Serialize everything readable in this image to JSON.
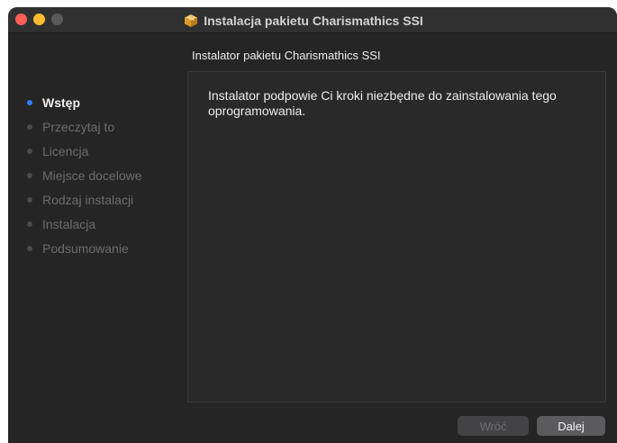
{
  "window": {
    "title": "Instalacja pakietu Charismathics SSI",
    "title_icon": "package-icon"
  },
  "header": {
    "heading": "Instalator pakietu Charismathics SSI"
  },
  "steps": [
    {
      "label": "Wstęp",
      "active": true
    },
    {
      "label": "Przeczytaj to",
      "active": false
    },
    {
      "label": "Licencja",
      "active": false
    },
    {
      "label": "Miejsce docelowe",
      "active": false
    },
    {
      "label": "Rodzaj instalacji",
      "active": false
    },
    {
      "label": "Instalacja",
      "active": false
    },
    {
      "label": "Podsumowanie",
      "active": false
    }
  ],
  "content": {
    "text": "Instalator podpowie Ci kroki niezbędne do zainstalowania tego oprogramowania."
  },
  "buttons": {
    "back_label": "Wróć",
    "next_label": "Dalej"
  },
  "colors": {
    "active_step": "#2f7df6",
    "close": "#fe5f57",
    "minimize": "#febc2e"
  }
}
